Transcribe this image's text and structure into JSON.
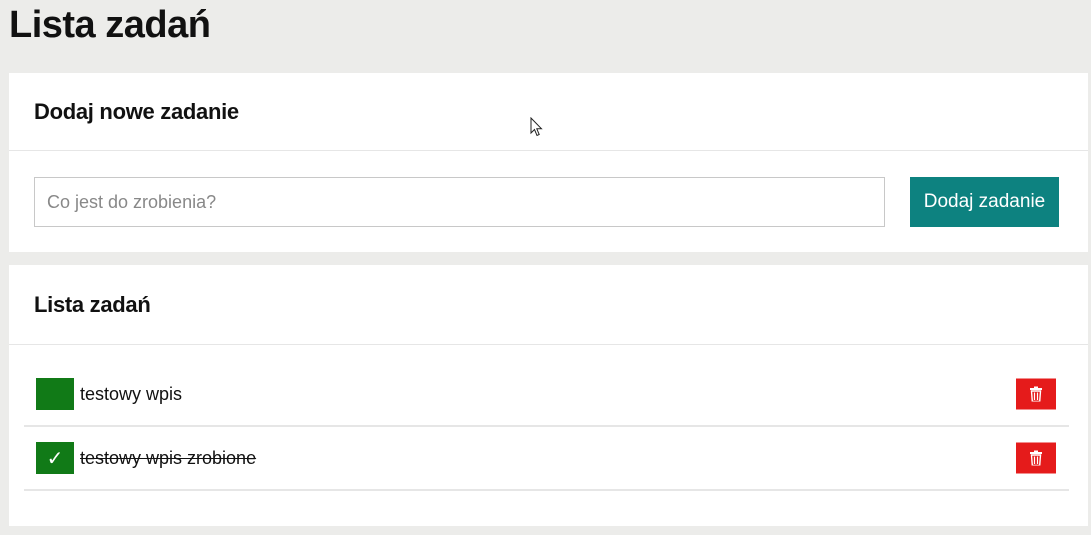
{
  "page": {
    "title": "Lista zadań"
  },
  "add_panel": {
    "heading": "Dodaj nowe zadanie",
    "input_placeholder": "Co jest do zrobienia?",
    "input_value": "",
    "button_label": "Dodaj zadanie"
  },
  "list_panel": {
    "heading": "Lista zadań",
    "tasks": [
      {
        "text": "testowy wpis",
        "done": false,
        "check_glyph": ""
      },
      {
        "text": "testowy wpis zrobione",
        "done": true,
        "check_glyph": "✓"
      }
    ]
  },
  "icons": {
    "checkbox": "checkbox-icon",
    "delete": "trash-icon",
    "cursor": "mouse-cursor-icon"
  },
  "colors": {
    "background": "#ececea",
    "panel": "#ffffff",
    "primary_button": "#0d8280",
    "checkbox": "#117a17",
    "delete_button": "#e51b1b"
  }
}
